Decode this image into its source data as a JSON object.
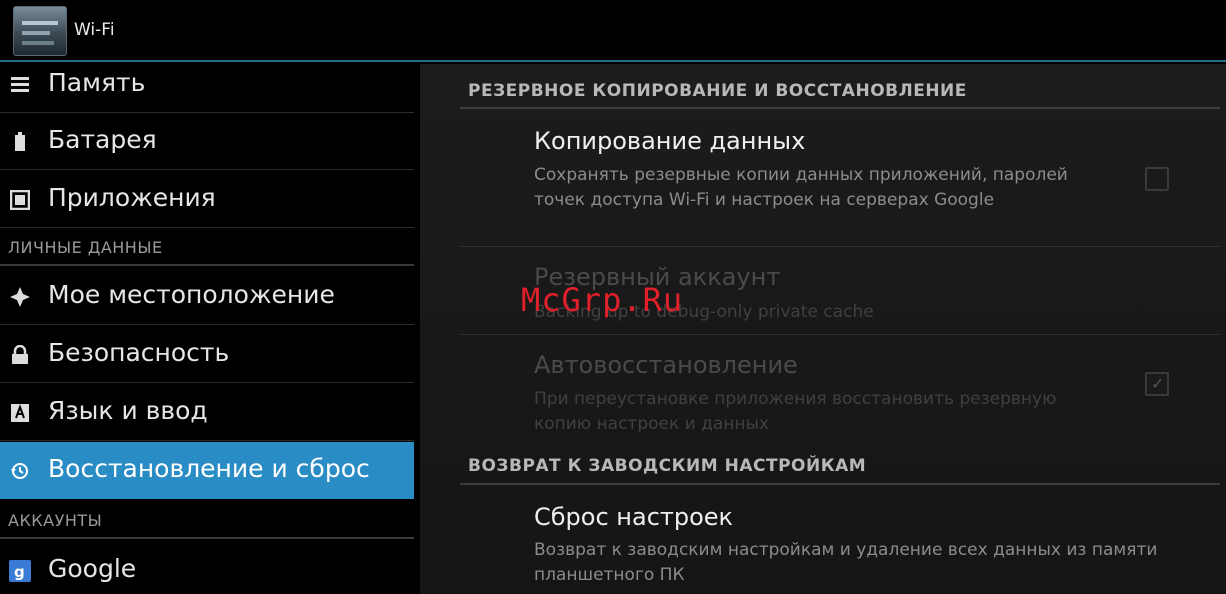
{
  "topbar": {
    "title": "Wi-Fi",
    "icon": "wifi-settings-icon"
  },
  "sidebar": {
    "items": [
      {
        "label": "Память",
        "icon": "storage-icon"
      },
      {
        "label": "Батарея",
        "icon": "battery-icon"
      },
      {
        "label": "Приложения",
        "icon": "apps-icon"
      },
      {
        "header": "ЛИЧНЫЕ ДАННЫЕ"
      },
      {
        "label": "Мое местоположение",
        "icon": "location-icon"
      },
      {
        "label": "Безопасность",
        "icon": "lock-icon"
      },
      {
        "label": "Язык и ввод",
        "icon": "keyboard-icon"
      },
      {
        "label": "Восстановление и сброс",
        "icon": "restore-icon",
        "selected": true
      },
      {
        "header": "АККАУНТЫ"
      },
      {
        "label": "Google",
        "icon": "google-icon"
      }
    ]
  },
  "main": {
    "section_backup": "РЕЗЕРВНОЕ КОПИРОВАНИЕ И ВОССТАНОВЛЕНИЕ",
    "backup_data": {
      "title": "Копирование данных",
      "summary": "Сохранять резервные копии данных приложений, паролей точек доступа Wi-Fi и настроек на серверах Google",
      "checked": false
    },
    "backup_account": {
      "title": "Резервный аккаунт",
      "summary": "Backing up to debug-only private cache"
    },
    "auto_restore": {
      "title": "Автовосстановление",
      "summary": "При переустановке приложения восстановить резервную копию настроек и данных",
      "checked": true
    },
    "section_factory": "ВОЗВРАТ К ЗАВОДСКИМ НАСТРОЙКАМ",
    "factory_reset": {
      "title": "Сброс настроек",
      "summary": "Возврат к заводским настройкам и удаление всех данных из памяти планшетного ПК"
    }
  },
  "watermark": "McGrp.Ru",
  "colors": {
    "accent": "#2a8cc4",
    "watermark": "#e0202a"
  }
}
